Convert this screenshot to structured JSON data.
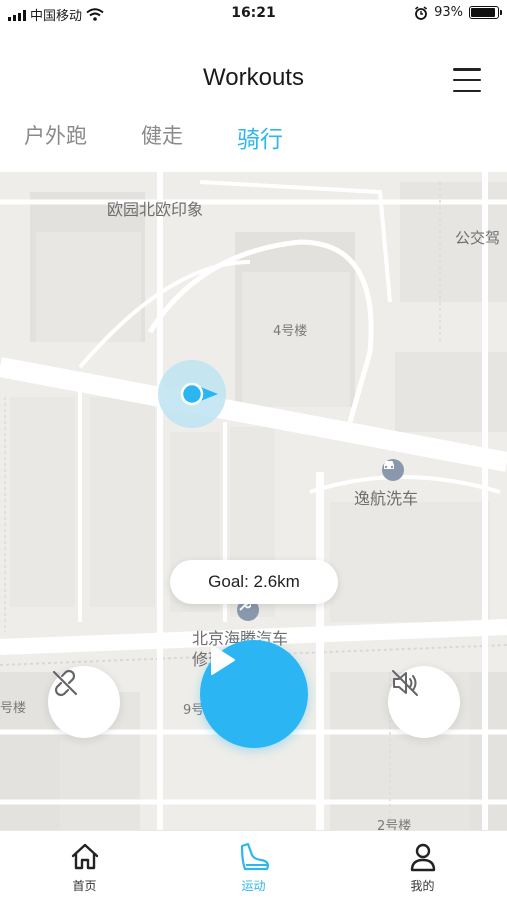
{
  "status_bar": {
    "carrier": "中国移动",
    "time": "16:21",
    "battery": "93%",
    "battery_level": 0.93,
    "icons": [
      "signal-icon",
      "wifi-icon",
      "alarm-icon",
      "battery-icon"
    ]
  },
  "header": {
    "title": "Workouts",
    "menu_icon": "hamburger-menu-icon"
  },
  "tabs": [
    {
      "label": "户外跑",
      "active": false
    },
    {
      "label": "健走",
      "active": false
    },
    {
      "label": "骑行",
      "active": true
    }
  ],
  "map": {
    "labels": {
      "poi_1": "欧园北欧印象",
      "poi_2": "公交驾",
      "building_4": "4号楼",
      "car_wash": "逸航洗车",
      "repair_line1": "北京海腾汽车",
      "repair_line2": "修理有限公司",
      "building_left": "号楼",
      "building_9": "9号",
      "building_2": "2号楼"
    },
    "location_marker": "current-location-icon"
  },
  "goal": {
    "text": "Goal: 2.6km"
  },
  "controls": {
    "left_icon": "link-broken-icon",
    "play_icon": "play-icon",
    "right_icon": "sound-muted-icon"
  },
  "bottom_nav": [
    {
      "label": "首页",
      "icon": "home-icon",
      "active": false
    },
    {
      "label": "运动",
      "icon": "shoe-icon",
      "active": true
    },
    {
      "label": "我的",
      "icon": "profile-icon",
      "active": false
    }
  ],
  "colors": {
    "accent": "#2db7f0",
    "map_background": "#efeeec"
  }
}
